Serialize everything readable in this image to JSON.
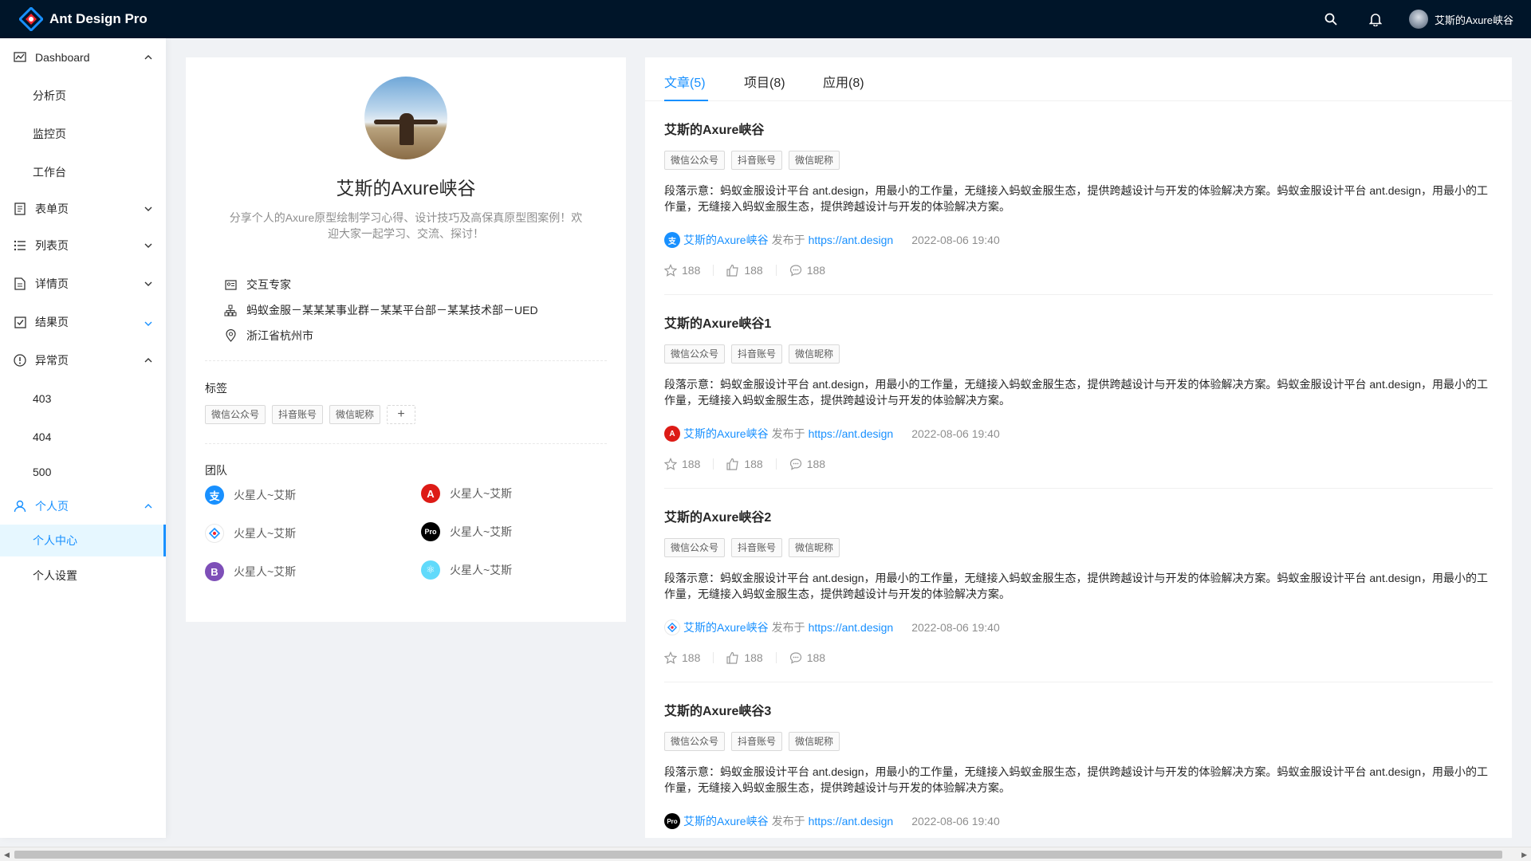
{
  "app": {
    "title": "Ant Design Pro",
    "brand_color": "#1890ff",
    "header_bg": "#001529"
  },
  "header": {
    "user_name": "艾斯的Axure峡谷"
  },
  "sidebar": {
    "items": [
      {
        "label": "Dashboard",
        "children": [
          "分析页",
          "监控页",
          "工作台"
        ]
      },
      {
        "label": "表单页"
      },
      {
        "label": "列表页"
      },
      {
        "label": "详情页"
      },
      {
        "label": "结果页"
      },
      {
        "label": "异常页",
        "children": [
          "403",
          "404",
          "500"
        ]
      },
      {
        "label": "个人页",
        "children": [
          "个人中心",
          "个人设置"
        ]
      }
    ],
    "selected": "个人中心"
  },
  "profile": {
    "name": "艾斯的Axure峡谷",
    "desc_line1": "分享个人的Axure原型绘制学习心得、设计技巧及高保真原型图案例！欢",
    "desc_line2": "迎大家一起学习、交流、探讨！",
    "title": "交互专家",
    "org": "蚂蚁金服－某某某事业群－某某平台部－某某技术部－UED",
    "location": "浙江省杭州市",
    "tags_label": "标签",
    "tags": [
      "微信公众号",
      "抖音账号",
      "微信昵称"
    ],
    "add_tag": "+",
    "team_label": "团队",
    "team": [
      "火星人~艾斯",
      "火星人~艾斯",
      "火星人~艾斯",
      "火星人~艾斯",
      "火星人~艾斯",
      "火星人~艾斯"
    ]
  },
  "tabs": [
    "文章(5)",
    "项目(8)",
    "应用(8)"
  ],
  "articles": [
    {
      "title": "艾斯的Axure峡谷",
      "tags": [
        "微信公众号",
        "抖音账号",
        "微信昵称"
      ],
      "para": "段落示意：蚂蚁金服设计平台 ant.design，用最小的工作量，无缝接入蚂蚁金服生态，提供跨越设计与开发的体验解决方案。蚂蚁金服设计平台 ant.design，用最小的工作量，无缝接入蚂蚁金服生态，提供跨越设计与开发的体验解决方案。",
      "author": "艾斯的Axure峡谷",
      "published": "发布于",
      "url": "https://ant.design",
      "time": "2022-08-06 19:40",
      "star": "188",
      "like": "188",
      "message": "188"
    },
    {
      "title": "艾斯的Axure峡谷1",
      "tags": [
        "微信公众号",
        "抖音账号",
        "微信昵称"
      ],
      "para": "段落示意：蚂蚁金服设计平台 ant.design，用最小的工作量，无缝接入蚂蚁金服生态，提供跨越设计与开发的体验解决方案。蚂蚁金服设计平台 ant.design，用最小的工作量，无缝接入蚂蚁金服生态，提供跨越设计与开发的体验解决方案。",
      "author": "艾斯的Axure峡谷",
      "published": "发布于",
      "url": "https://ant.design",
      "time": "2022-08-06 19:40",
      "star": "188",
      "like": "188",
      "message": "188"
    },
    {
      "title": "艾斯的Axure峡谷2",
      "tags": [
        "微信公众号",
        "抖音账号",
        "微信昵称"
      ],
      "para": "段落示意：蚂蚁金服设计平台 ant.design，用最小的工作量，无缝接入蚂蚁金服生态，提供跨越设计与开发的体验解决方案。蚂蚁金服设计平台 ant.design，用最小的工作量，无缝接入蚂蚁金服生态，提供跨越设计与开发的体验解决方案。",
      "author": "艾斯的Axure峡谷",
      "published": "发布于",
      "url": "https://ant.design",
      "time": "2022-08-06 19:40",
      "star": "188",
      "like": "188",
      "message": "188"
    },
    {
      "title": "艾斯的Axure峡谷3",
      "tags": [
        "微信公众号",
        "抖音账号",
        "微信昵称"
      ],
      "para": "段落示意：蚂蚁金服设计平台 ant.design，用最小的工作量，无缝接入蚂蚁金服生态，提供跨越设计与开发的体验解决方案。蚂蚁金服设计平台 ant.design，用最小的工作量，无缝接入蚂蚁金服生态，提供跨越设计与开发的体验解决方案。",
      "author": "艾斯的Axure峡谷",
      "published": "发布于",
      "url": "https://ant.design",
      "time": "2022-08-06 19:40"
    }
  ]
}
